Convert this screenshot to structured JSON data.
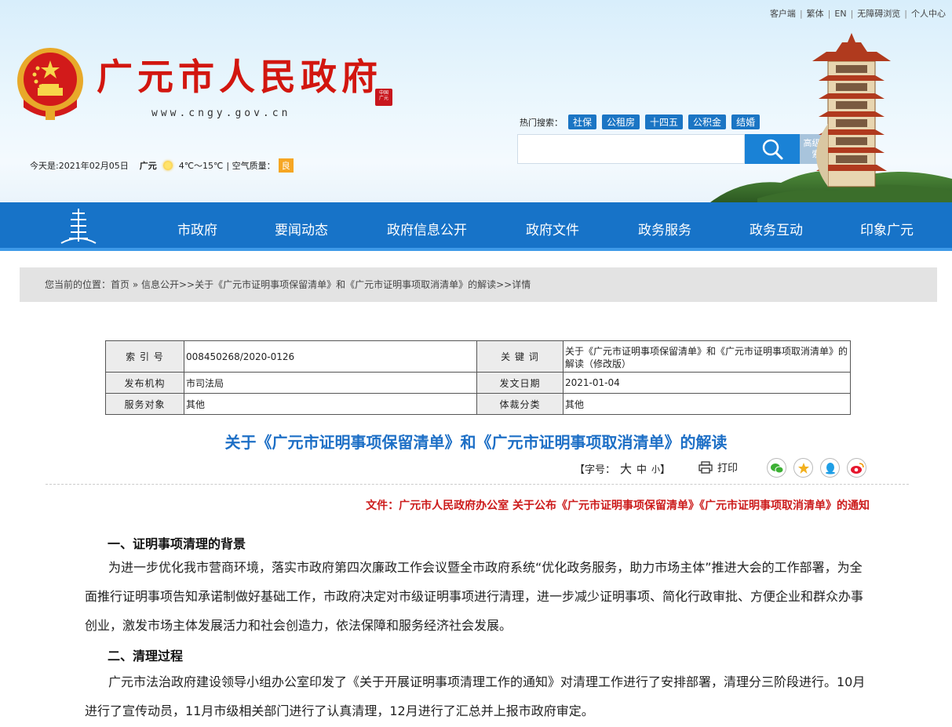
{
  "top_links": [
    "客户端",
    "繁体",
    "EN",
    "无障碍浏览",
    "个人中心"
  ],
  "site": {
    "title": "广元市人民政府",
    "url": "www.cngy.gov.cn"
  },
  "weather": {
    "date": "今天是:2021年02月05日",
    "city": "广元",
    "temp": "4℃～15℃",
    "air_label": "| 空气质量：",
    "air_value": "良"
  },
  "search": {
    "hot_label": "热门搜索：",
    "hot_tags": [
      "社保",
      "公租房",
      "十四五",
      "公积金",
      "结婚"
    ],
    "placeholder": "",
    "advanced": "高级搜索"
  },
  "nav": [
    "市政府",
    "要闻动态",
    "政府信息公开",
    "政府文件",
    "政务服务",
    "政务互动",
    "印象广元"
  ],
  "breadcrumb": "您当前的位置：首页 » 信息公开>>关于《广元市证明事项保留清单》和《广元市证明事项取消清单》的解读>>详情",
  "meta": {
    "index_label": "索 引 号",
    "index_value": "008450268/2020-0126",
    "keyword_label": "关 键 词",
    "keyword_value": "关于《广元市证明事项保留清单》和《广元市证明事项取消清单》的解读（修改版）",
    "publisher_label": "发布机构",
    "publisher_value": "市司法局",
    "date_label": "发文日期",
    "date_value": "2021-01-04",
    "service_label": "服务对象",
    "service_value": "其他",
    "genre_label": "体裁分类",
    "genre_value": "其他"
  },
  "article": {
    "title": "关于《广元市证明事项保留清单》和《广元市证明事项取消清单》的解读",
    "font_label": "【字号：",
    "font_large": "大",
    "font_medium": "中",
    "font_small": "小",
    "font_close": "】",
    "print": "打印",
    "source": "文件：广元市人民政府办公室 关于公布《广元市证明事项保留清单》《广元市证明事项取消清单》的通知",
    "section1_title": "一、证明事项清理的背景",
    "section1_text": "为进一步优化我市营商环境，落实市政府第四次廉政工作会议暨全市政府系统“优化政务服务，助力市场主体”推进大会的工作部署，为全面推行证明事项告知承诺制做好基础工作，市政府决定对市级证明事项进行清理，进一步减少证明事项、简化行政审批、方便企业和群众办事创业，激发市场主体发展活力和社会创造力，依法保障和服务经济社会发展。",
    "section2_title": "二、清理过程",
    "section2_text": "广元市法治政府建设领导小组办公室印发了《关于开展证明事项清理工作的通知》对清理工作进行了安排部署，清理分三阶段进行。10月进行了宣传动员，11月市级相关部门进行了认真清理，12月进行了汇总并上报市政府审定。"
  },
  "colors": {
    "nav_blue": "#1773c8",
    "title_red": "#d2160f",
    "article_blue": "#1d6fc6",
    "source_red": "#cc1b1b"
  }
}
